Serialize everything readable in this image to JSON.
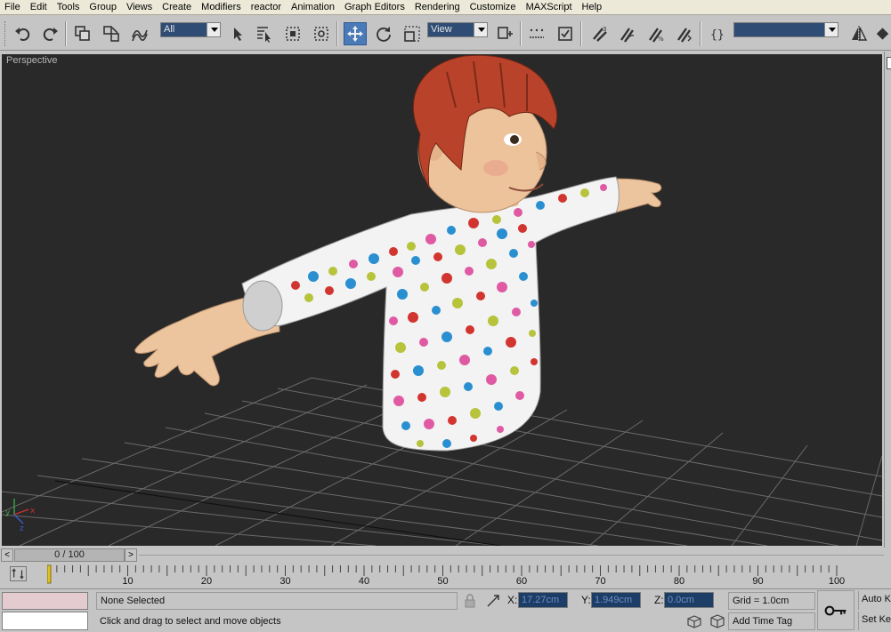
{
  "menu": {
    "items": [
      "File",
      "Edit",
      "Tools",
      "Group",
      "Views",
      "Create",
      "Modifiers",
      "reactor",
      "Animation",
      "Graph Editors",
      "Rendering",
      "Customize",
      "MAXScript",
      "Help"
    ]
  },
  "toolbar": {
    "selection_filter": "All",
    "reference_coord": "View",
    "named_selection": "",
    "icons": [
      "undo-icon",
      "redo-icon",
      "select-and-link-icon",
      "unlink-icon",
      "bind-space-warp-icon",
      "select-object-icon",
      "select-by-name-icon",
      "rectangular-region-icon",
      "window-crossing-icon",
      "select-and-move-icon",
      "select-and-rotate-icon",
      "select-and-scale-icon",
      "pivot-center-icon",
      "manipulate-icon",
      "keyboard-shortcut-icon",
      "snap-toggle-icon",
      "angle-snap-icon",
      "percent-snap-icon",
      "spinner-snap-icon",
      "edit-named-selection-icon",
      "mirror-icon",
      "align-icon"
    ]
  },
  "viewport": {
    "label": "Perspective",
    "background": "#292929"
  },
  "time_slider": {
    "frame_readout": "0 / 100",
    "prev_label": "<",
    "next_label": ">"
  },
  "trackbar": {
    "ticks": [
      "0",
      "10",
      "20",
      "30",
      "40",
      "50",
      "60",
      "70",
      "80",
      "90",
      "100"
    ]
  },
  "status": {
    "selection": "None Selected",
    "prompt": "Click and drag to select and move objects",
    "x_label": "X:",
    "x_value": "17.27cm",
    "y_label": "Y:",
    "y_value": "1.949cm",
    "z_label": "Z:",
    "z_value": "0.0cm",
    "grid": "Grid = 1.0cm",
    "add_time_tag": "Add Time Tag",
    "auto_key": "Auto Key",
    "set_key": "Set Key"
  }
}
